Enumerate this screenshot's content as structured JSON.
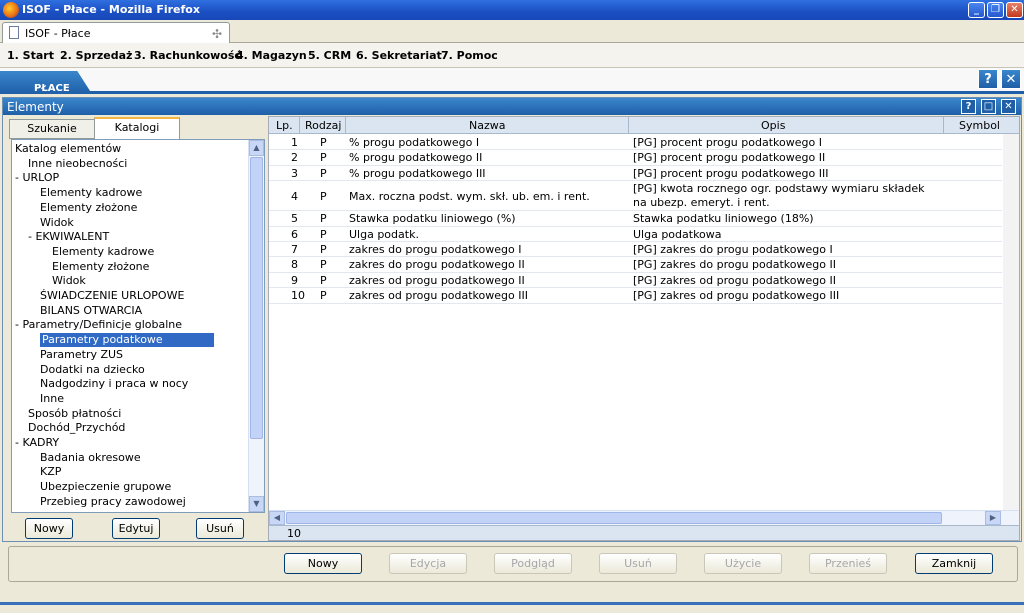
{
  "window": {
    "title": "ISOF - Płace - Mozilla Firefox"
  },
  "browser_tab": {
    "title": "ISOF - Płace"
  },
  "menu": [
    "1. Start",
    "2. Sprzedaż",
    "3. Rachunkowość",
    "4. Magazyn",
    "5. CRM",
    "6. Sekretariat",
    "7. Pomoc"
  ],
  "module_tab": {
    "label": "PŁACE"
  },
  "panel": {
    "title": "Elementy",
    "tabs": [
      "Szukanie",
      "Katalogi"
    ],
    "active_tab": "Katalogi"
  },
  "tree": [
    {
      "label": "Katalog elementów",
      "depth": 0,
      "prefix": ""
    },
    {
      "label": "Inne nieobecności",
      "depth": 1,
      "prefix": ""
    },
    {
      "label": "URLOP",
      "depth": 0,
      "prefix": "-"
    },
    {
      "label": "Elementy kadrowe",
      "depth": 2,
      "prefix": ""
    },
    {
      "label": "Elementy złożone",
      "depth": 2,
      "prefix": ""
    },
    {
      "label": "Widok",
      "depth": 2,
      "prefix": ""
    },
    {
      "label": "EKWIWALENT",
      "depth": 1,
      "prefix": "-"
    },
    {
      "label": "Elementy kadrowe",
      "depth": 3,
      "prefix": ""
    },
    {
      "label": "Elementy złożone",
      "depth": 3,
      "prefix": ""
    },
    {
      "label": "Widok",
      "depth": 3,
      "prefix": ""
    },
    {
      "label": "ŚWIADCZENIE URLOPOWE",
      "depth": 2,
      "prefix": ""
    },
    {
      "label": "BILANS OTWARCIA",
      "depth": 2,
      "prefix": ""
    },
    {
      "label": "Parametry/Definicje globalne",
      "depth": 0,
      "prefix": "-"
    },
    {
      "label": "Parametry podatkowe",
      "depth": 2,
      "prefix": "",
      "selected": true
    },
    {
      "label": "Parametry ZUS",
      "depth": 2,
      "prefix": ""
    },
    {
      "label": "Dodatki na dziecko",
      "depth": 2,
      "prefix": ""
    },
    {
      "label": "Nadgodziny i praca w nocy",
      "depth": 2,
      "prefix": ""
    },
    {
      "label": "Inne",
      "depth": 2,
      "prefix": ""
    },
    {
      "label": "Sposób płatności",
      "depth": 1,
      "prefix": ""
    },
    {
      "label": "Dochód_Przychód",
      "depth": 1,
      "prefix": ""
    },
    {
      "label": "KADRY",
      "depth": 0,
      "prefix": "-"
    },
    {
      "label": "Badania okresowe",
      "depth": 2,
      "prefix": ""
    },
    {
      "label": "KZP",
      "depth": 2,
      "prefix": ""
    },
    {
      "label": "Ubezpieczenie grupowe",
      "depth": 2,
      "prefix": ""
    },
    {
      "label": "Przebieg pracy zawodowej",
      "depth": 2,
      "prefix": ""
    }
  ],
  "tree_buttons": [
    "Nowy",
    "Edytuj",
    "Usuń"
  ],
  "grid": {
    "columns": [
      "Lp.",
      "Rodzaj",
      "Nazwa",
      "Opis",
      "Symbol"
    ],
    "rows": [
      {
        "lp": "1",
        "rodzaj": "P",
        "nazwa": "% progu podatkowego I",
        "opis": [
          "[PG] procent progu podatkowego I"
        ]
      },
      {
        "lp": "2",
        "rodzaj": "P",
        "nazwa": "% progu podatkowego II",
        "opis": [
          "[PG] procent progu podatkowego II"
        ]
      },
      {
        "lp": "3",
        "rodzaj": "P",
        "nazwa": "% progu podatkowego III",
        "opis": [
          "[PG] procent progu podatkowego III"
        ]
      },
      {
        "lp": "4",
        "rodzaj": "P",
        "nazwa": "Max. roczna podst. wym. skł. ub. em. i rent.",
        "opis": [
          "[PG] kwota rocznego ogr. podstawy wymiaru składek",
          "na ubezp. emeryt. i rent."
        ]
      },
      {
        "lp": "5",
        "rodzaj": "P",
        "nazwa": "Stawka podatku liniowego (%)",
        "opis": [
          "Stawka podatku liniowego (18%)"
        ]
      },
      {
        "lp": "6",
        "rodzaj": "P",
        "nazwa": "Ulga podatk.",
        "opis": [
          "Ulga podatkowa"
        ]
      },
      {
        "lp": "7",
        "rodzaj": "P",
        "nazwa": "zakres do progu podatkowego I",
        "opis": [
          "[PG] zakres do progu podatkowego I"
        ]
      },
      {
        "lp": "8",
        "rodzaj": "P",
        "nazwa": "zakres do progu podatkowego II",
        "opis": [
          "[PG] zakres do progu podatkowego II"
        ]
      },
      {
        "lp": "9",
        "rodzaj": "P",
        "nazwa": "zakres od progu podatkowego II",
        "opis": [
          "[PG] zakres od progu podatkowego II"
        ]
      },
      {
        "lp": "10",
        "rodzaj": "P",
        "nazwa": "zakres od progu podatkowego III",
        "opis": [
          "[PG] zakres od progu podatkowego III"
        ]
      }
    ],
    "footer_count": "10"
  },
  "actions": [
    {
      "label": "Nowy",
      "enabled": true
    },
    {
      "label": "Edycja",
      "enabled": false
    },
    {
      "label": "Podgląd",
      "enabled": false
    },
    {
      "label": "Usuń",
      "enabled": false
    },
    {
      "label": "Użycie",
      "enabled": false
    },
    {
      "label": "Przenieś",
      "enabled": false
    },
    {
      "label": "Zamknij",
      "enabled": true
    }
  ],
  "colors": {
    "accent": "#1f5fa8",
    "selection": "#316ac5"
  }
}
